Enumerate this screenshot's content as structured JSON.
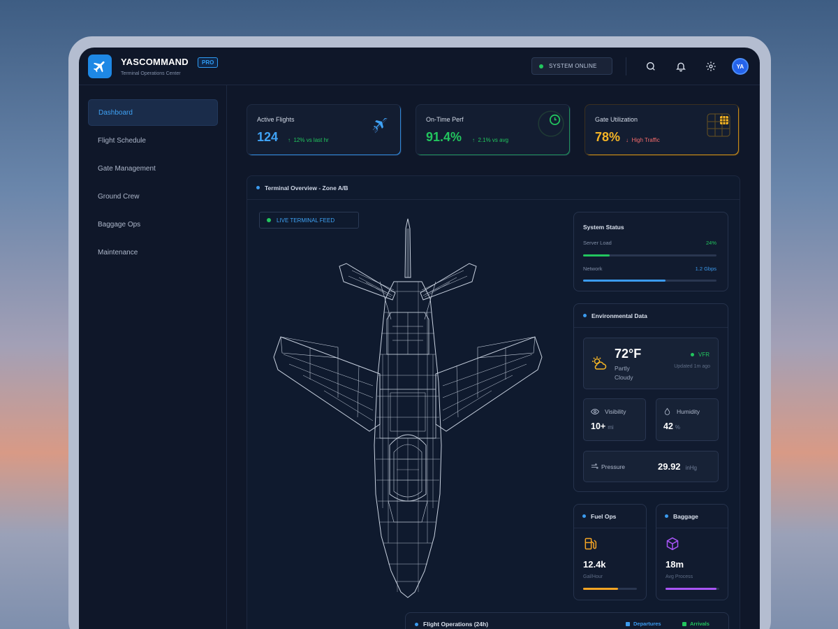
{
  "header": {
    "brand": "YASCOMMAND",
    "badge": "PRO",
    "subtitle": "Terminal Operations Center",
    "system_status": "SYSTEM ONLINE",
    "avatar_initials": "YA"
  },
  "sidebar": {
    "items": [
      {
        "label": "Dashboard",
        "active": true
      },
      {
        "label": "Flight Schedule"
      },
      {
        "label": "Gate Management"
      },
      {
        "label": "Ground Crew"
      },
      {
        "label": "Baggage Ops"
      },
      {
        "label": "Maintenance"
      }
    ]
  },
  "stats": [
    {
      "label": "Active Flights",
      "value": "124",
      "delta": "12% vs last hr",
      "delta_dir": "up",
      "color": "#3fa2f5",
      "icon": "plane-icon"
    },
    {
      "label": "On-Time Perf",
      "value": "91.4%",
      "delta": "2.1% vs avg",
      "delta_dir": "up",
      "color": "#22c55e",
      "icon": "clock-icon"
    },
    {
      "label": "Gate Utilization",
      "value": "78%",
      "delta": "High Traffic",
      "delta_dir": "down",
      "color": "#f5b526",
      "icon": "grid-icon"
    }
  ],
  "panel": {
    "title": "Terminal Overview - Zone A/B",
    "live_feed": "LIVE TERMINAL FEED"
  },
  "system_status": {
    "title": "System Status",
    "server_load": {
      "label": "Server Load",
      "value": "24%",
      "level": 0.2,
      "color": "#22c55e"
    },
    "network": {
      "label": "Network",
      "value": "1.2 Gbps",
      "level": 0.62,
      "color": "#3b9bef"
    }
  },
  "environment": {
    "title": "Environmental Data",
    "temperature": "72°F",
    "condition_line1": "Partly",
    "condition_line2": "Cloudy",
    "flight_rules": "VFR",
    "updated": "Updated 1m ago",
    "visibility": {
      "label": "Visibility",
      "value": "10+",
      "unit": "mi"
    },
    "humidity": {
      "label": "Humidity",
      "value": "42",
      "unit": "%"
    },
    "pressure": {
      "label": "Pressure",
      "value": "29.92",
      "unit": "inHg"
    }
  },
  "fuel_ops": {
    "title": "Fuel Ops",
    "value": "12.4k",
    "unit": "Gal/Hour",
    "level": 0.65,
    "color": "#f5a524"
  },
  "baggage": {
    "title": "Baggage",
    "value": "18m",
    "unit": "Avg Process",
    "level": 0.95,
    "color": "#a855f7"
  },
  "flight_ops": {
    "title": "Flight Operations (24h)",
    "legend": [
      {
        "label": "Departures",
        "color": "#3b9bef"
      },
      {
        "label": "Arrivals",
        "color": "#22c55e"
      }
    ]
  }
}
